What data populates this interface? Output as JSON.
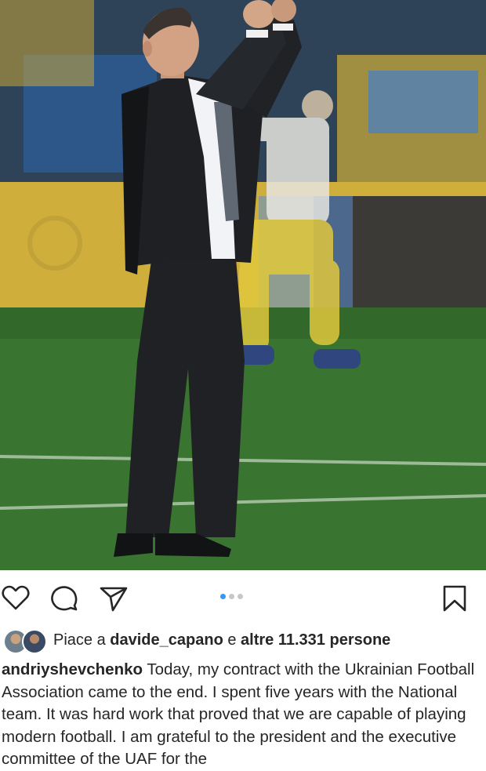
{
  "post": {
    "photo_alt": "Coach applauding on football pitch in a stadium",
    "carousel": {
      "total": 3,
      "active_index": 0
    }
  },
  "actions": {
    "like_icon": "heart-icon",
    "comment_icon": "comment-icon",
    "share_icon": "paper-plane-icon",
    "save_icon": "bookmark-icon"
  },
  "likes": {
    "prefix": "Piace a",
    "user": "davide_capano",
    "joiner": "e",
    "others": "altre 11.331 persone"
  },
  "caption": {
    "username": "andriyshevchenko",
    "text": " Today, my contract with the Ukrainian Football Association came to the end. I spent five years with the National team. It was hard work that proved that we are capable of playing modern football. I am grateful to the president and the executive committee of the UAF for the"
  },
  "colors": {
    "accent_blue": "#3897f0",
    "text": "#262626",
    "dot_inactive": "#c7c7c7"
  }
}
